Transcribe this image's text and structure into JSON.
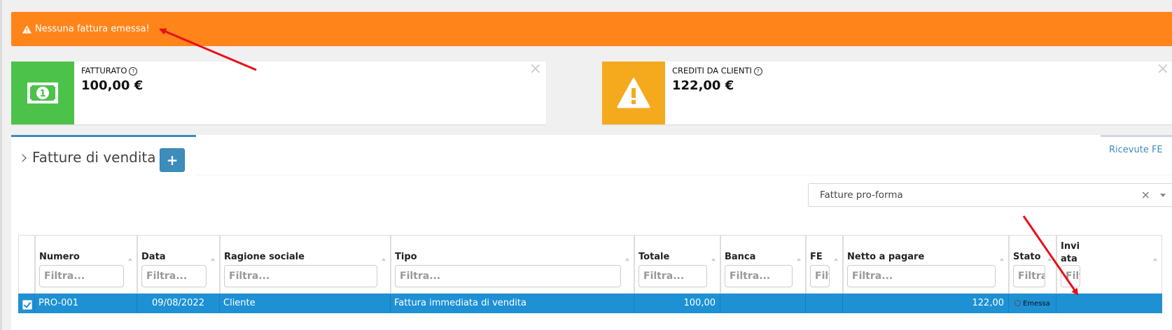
{
  "alert": {
    "text": "Nessuna fattura emessa!",
    "icon": "warning-icon",
    "color": "#ff851b"
  },
  "infoboxes": [
    {
      "label": "FATTURATO",
      "value": "100,00 €",
      "icon": "money-bill-icon",
      "color": "#4cc24a"
    },
    {
      "label": "CREDITI DA CLIENTI",
      "value": "122,00 €",
      "icon": "warning-icon",
      "color": "#f5aa1e"
    }
  ],
  "close_glyph": "×",
  "panel": {
    "title": "Fatture di vendita",
    "add_label": "+",
    "link_label": "Ricevute FE",
    "accent": "#3c8dbc"
  },
  "segment_select": {
    "value": "Fatture pro-forma",
    "clear_glyph": "×"
  },
  "table": {
    "columns": [
      {
        "name": "Numero",
        "placeholder": "Filtra..."
      },
      {
        "name": "Data",
        "placeholder": "Filtra..."
      },
      {
        "name": "Ragione sociale",
        "placeholder": "Filtra..."
      },
      {
        "name": "Tipo",
        "placeholder": "Filtra..."
      },
      {
        "name": "Totale",
        "placeholder": "Filtra..."
      },
      {
        "name": "Banca",
        "placeholder": "Filtra..."
      },
      {
        "name": "FE",
        "placeholder": "Filtra..."
      },
      {
        "name": "Netto a pagare",
        "placeholder": "Filtra..."
      },
      {
        "name": "Stato",
        "placeholder": "Filtra..."
      },
      {
        "name": "Invi\nata",
        "placeholder": "Filtra..."
      }
    ],
    "row": {
      "numero": "PRO-001",
      "data": "09/08/2022",
      "ragione_sociale": "Cliente",
      "tipo": "Fattura immediata di vendita",
      "totale": "100,00",
      "banca": "",
      "fe": "",
      "netto": "122,00",
      "stato": "Emessa",
      "inviata": ""
    },
    "row_color": "#1e90d4"
  }
}
